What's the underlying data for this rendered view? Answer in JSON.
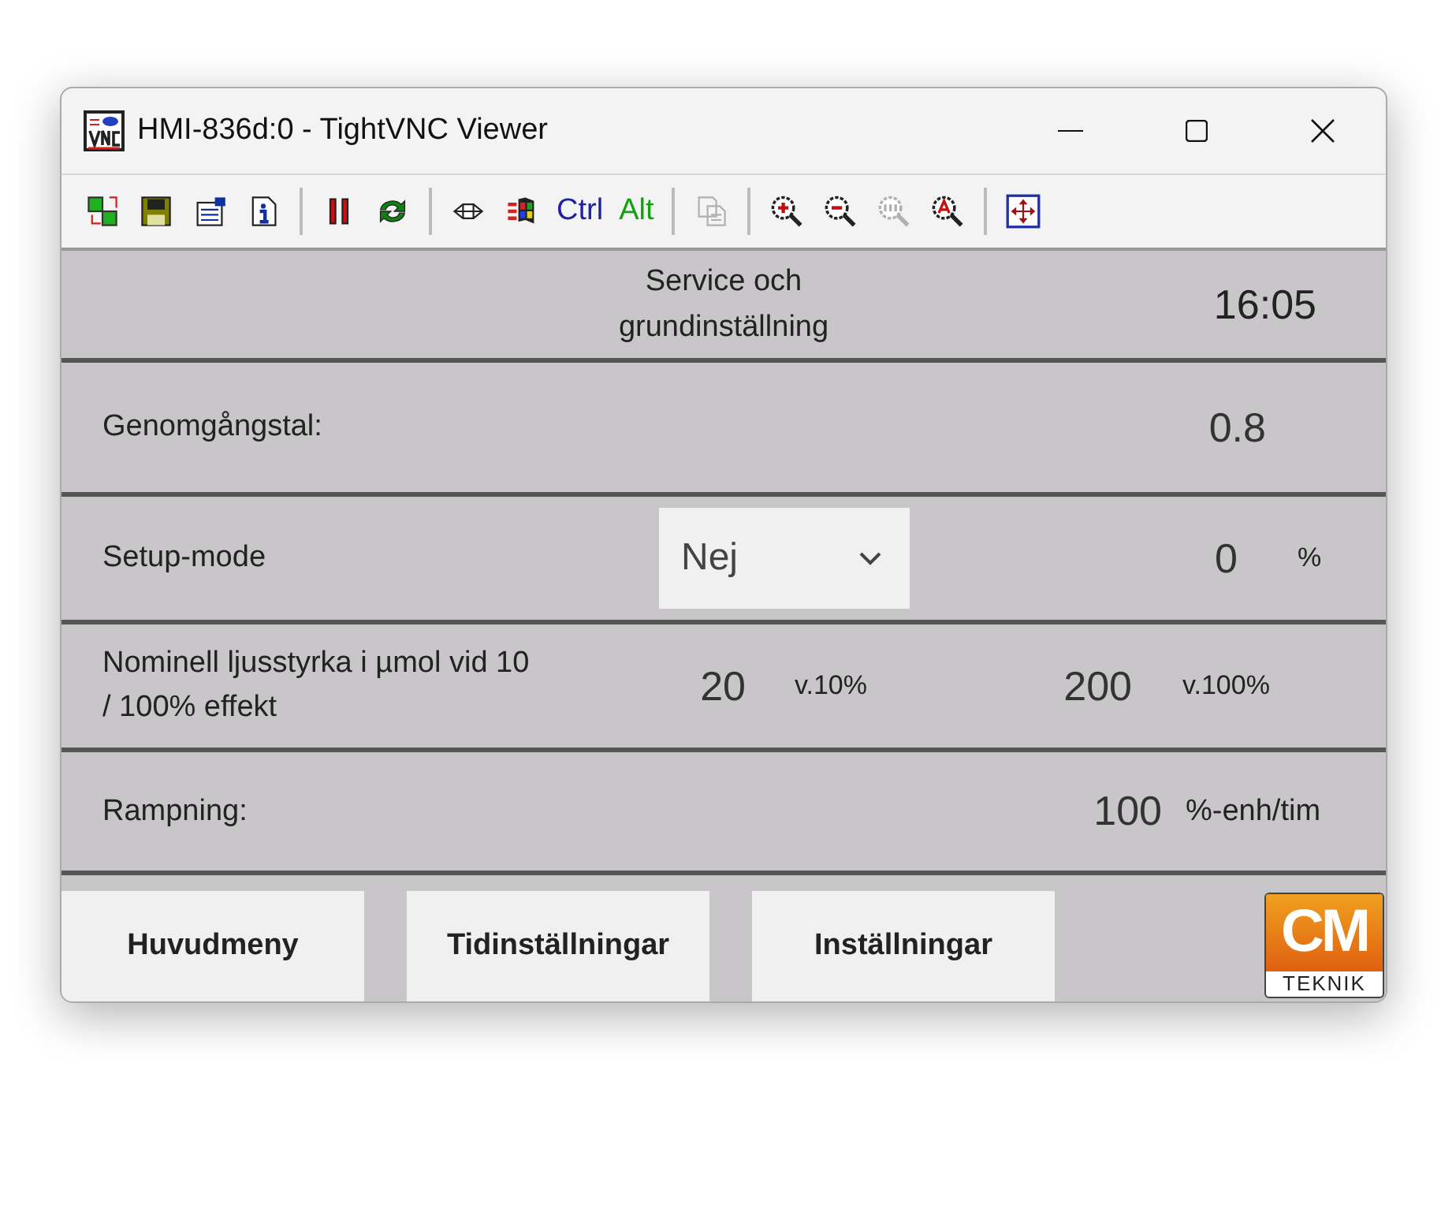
{
  "window": {
    "title": "HMI-836d:0 - TightVNC Viewer"
  },
  "toolbar": [
    {
      "kind": "connections",
      "disabled": false
    },
    {
      "kind": "save",
      "disabled": false
    },
    {
      "kind": "options",
      "disabled": false
    },
    {
      "kind": "info",
      "disabled": false
    },
    {
      "kind": "separator"
    },
    {
      "kind": "pause",
      "disabled": false
    },
    {
      "kind": "refresh",
      "disabled": false
    },
    {
      "kind": "separator"
    },
    {
      "kind": "keys",
      "disabled": false
    },
    {
      "kind": "flag",
      "disabled": false
    },
    {
      "kind": "text",
      "label": "Ctrl",
      "color": "#2020a0"
    },
    {
      "kind": "text",
      "label": "Alt",
      "color": "#10a010"
    },
    {
      "kind": "separator"
    },
    {
      "kind": "copy",
      "disabled": true
    },
    {
      "kind": "separator"
    },
    {
      "kind": "zoom-in",
      "disabled": false
    },
    {
      "kind": "zoom-out",
      "disabled": false
    },
    {
      "kind": "zoom-100",
      "disabled": true
    },
    {
      "kind": "zoom-auto",
      "disabled": false
    },
    {
      "kind": "separator"
    },
    {
      "kind": "fullscreen",
      "disabled": false
    }
  ],
  "header": {
    "title": "Service och grundinställning",
    "time": "16:05"
  },
  "rows": [
    {
      "kind": "value",
      "label": "Genomgångstal:",
      "value": "0.8"
    },
    {
      "kind": "select",
      "label": "Setup-mode",
      "select": "Nej",
      "value": "0",
      "unit": "%"
    },
    {
      "kind": "pair",
      "label": "Nominell ljusstyrka i µmol vid 10 / 100% effekt",
      "value_1": "20",
      "unit_1": "v.10%",
      "value": "200",
      "unit": "v.100%"
    },
    {
      "kind": "unit",
      "label": "Rampning:",
      "value": "100",
      "unit": "%-enh/tim"
    }
  ],
  "buttons": [
    "Huvudmeny",
    "Tidinställningar",
    "Inställningar"
  ],
  "logo": {
    "mark": "CM",
    "name": "TEKNIK"
  }
}
